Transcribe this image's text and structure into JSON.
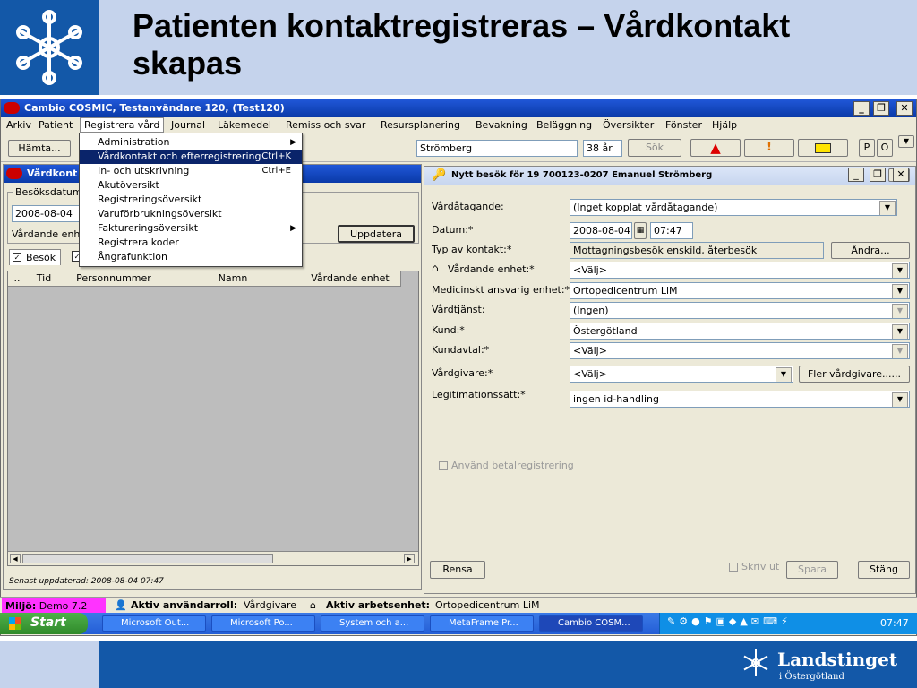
{
  "slide": {
    "title": "Patienten kontaktregistreras – Vårdkontakt skapas",
    "footer_logo_line1": "Landstinget",
    "footer_logo_line2": "i Östergötland"
  },
  "app": {
    "title": "Cambio COSMIC, Testanvändare 120, (Test120)",
    "menu": [
      "Arkiv",
      "Patient",
      "Registrera vård",
      "Journal",
      "Läkemedel",
      "Remiss och svar",
      "Resursplanering",
      "Bevakning",
      "Beläggning",
      "Översikter",
      "Fönster",
      "Hjälp"
    ],
    "toolbar": {
      "hamta": "Hämta...",
      "patient_name": "Strömberg",
      "age": "38 år",
      "search": "Sök",
      "p_label": "P",
      "o_label": "O"
    },
    "dropdown_menu": [
      {
        "label": "Administration",
        "shortcut": "",
        "submenu": true,
        "highlighted": false
      },
      {
        "label": "Vårdkontakt och efterregistrering",
        "shortcut": "Ctrl+K",
        "submenu": false,
        "highlighted": true
      },
      {
        "label": "In- och utskrivning",
        "shortcut": "Ctrl+E",
        "submenu": false,
        "highlighted": false
      },
      {
        "label": "Akutöversikt",
        "shortcut": "",
        "submenu": false,
        "highlighted": false
      },
      {
        "label": "Registreringsöversikt",
        "shortcut": "",
        "submenu": false,
        "highlighted": false
      },
      {
        "label": "Varuförbrukningsöversikt",
        "shortcut": "",
        "submenu": false,
        "highlighted": false
      },
      {
        "label": "Faktureringsöversikt",
        "shortcut": "",
        "submenu": true,
        "highlighted": false
      },
      {
        "label": "Registrera koder",
        "shortcut": "",
        "submenu": false,
        "highlighted": false
      },
      {
        "label": "Ångrafunktion",
        "shortcut": "",
        "submenu": false,
        "highlighted": false
      }
    ]
  },
  "left_window": {
    "title": "Vårdkont",
    "group_label": "Besöksdatum",
    "date": "2008-08-04",
    "vardande_label": "Vårdande enh",
    "update_button": "Uppdatera",
    "tab_besok": "Besök",
    "columns": [
      "..",
      "Tid",
      "Personnummer",
      "Namn",
      "Vårdande enhet"
    ],
    "last_updated": "Senast uppdaterad: 2008-08-04 07:47"
  },
  "right_window": {
    "title": "Nytt besök för 19 700123-0207 Emanuel Strömberg",
    "fields": [
      {
        "label": "Vårdåtagande:",
        "value": "(Inget kopplat vårdåtagande)"
      },
      {
        "label": "Datum:*",
        "date": "2008-08-04",
        "time": "07:47"
      },
      {
        "label": "Typ av kontakt:*",
        "value": "Mottagningsbesök enskild, återbesök",
        "button": "Ändra..."
      },
      {
        "label": "Vårdande enhet:*",
        "value": "<Välj>"
      },
      {
        "label": "Medicinskt ansvarig enhet:*",
        "value": "Ortopedicentrum LiM"
      },
      {
        "label": "Vårdtjänst:",
        "value": "(Ingen)"
      },
      {
        "label": "Kund:*",
        "value": "Östergötland"
      },
      {
        "label": "Kundavtal:*",
        "value": "<Välj>"
      },
      {
        "label": "Vårdgivare:*",
        "value": "<Välj>",
        "button": "Fler vårdgivare......"
      },
      {
        "label": "Legitimationssätt:*",
        "value": "ingen id-handling"
      }
    ],
    "checkbox_label": "Använd betalregistrering",
    "rensa": "Rensa",
    "skriv_ut": "Skriv ut",
    "spara": "Spara",
    "stang": "Stäng"
  },
  "statusbar": {
    "miljo_label": "Miljö:",
    "miljo_value": "Demo 7.2",
    "roll_label": "Aktiv användarroll:",
    "roll_value": "Vårdgivare",
    "enhet_label": "Aktiv arbetsenhet:",
    "enhet_value": "Ortopedicentrum LiM"
  },
  "taskbar": {
    "start": "Start",
    "tasks": [
      "Microsoft Out...",
      "Microsoft Po...",
      "System och a...",
      "MetaFrame Pr...",
      "Cambio COSM..."
    ],
    "clock": "07:47"
  },
  "colors": {
    "slide_blue": "#1358a8",
    "slide_light": "#c5d3ec",
    "title_bar": "#0a3aa8",
    "menu_highlight": "#0a246a",
    "miljo_bg": "#ff33ff"
  }
}
